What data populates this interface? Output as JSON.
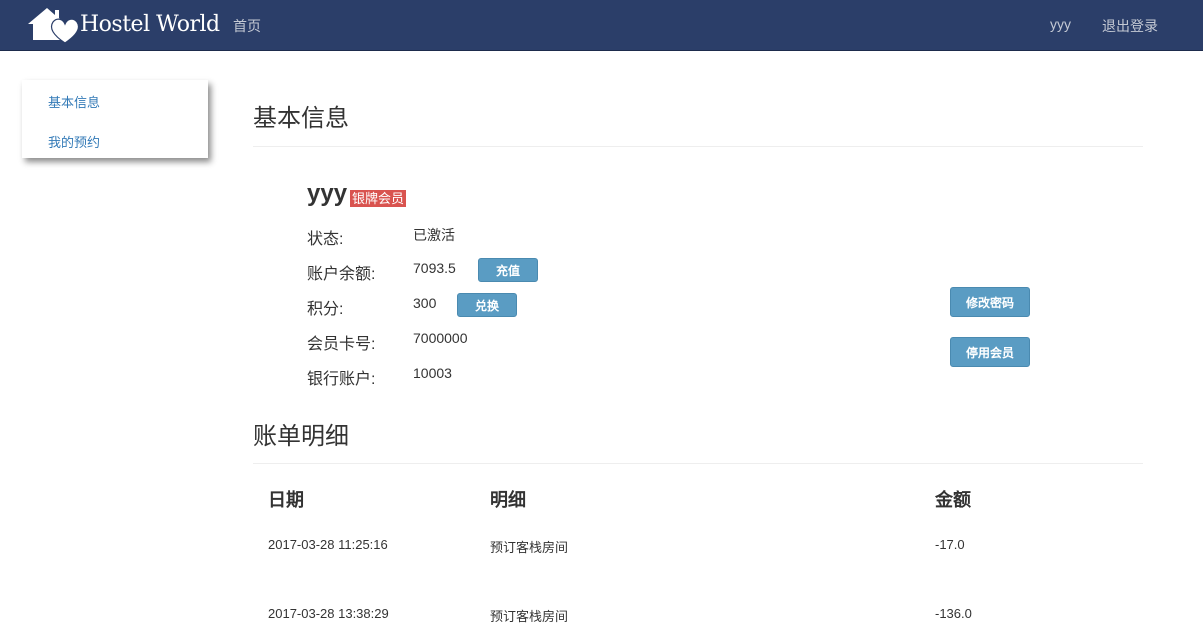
{
  "navbar": {
    "brand": "Hostel World",
    "home": "首页",
    "username": "yyy",
    "logout": "退出登录",
    "background": "#2b3e69"
  },
  "sidebar": {
    "items": [
      {
        "label": "基本信息"
      },
      {
        "label": "我的预约"
      }
    ]
  },
  "basic_info": {
    "title": "基本信息",
    "username": "yyy",
    "badge": "银牌会员",
    "fields": [
      {
        "label": "状态:",
        "value": "已激活"
      },
      {
        "label": "账户余额:",
        "value": "7093.5"
      },
      {
        "label": "积分:",
        "value": "300"
      },
      {
        "label": "会员卡号:",
        "value": "7000000"
      },
      {
        "label": "银行账户:",
        "value": "10003"
      }
    ],
    "recharge_button": "充值",
    "exchange_button": "兑换",
    "change_password_button": "修改密码",
    "deactivate_button": "停用会员"
  },
  "bill": {
    "title": "账单明细",
    "columns": [
      "日期",
      "明细",
      "金额"
    ],
    "rows": [
      {
        "date": "2017-03-28 11:25:16",
        "detail": "预订客栈房间",
        "amount": "-17.0"
      },
      {
        "date": "2017-03-28 13:38:29",
        "detail": "预订客栈房间",
        "amount": "-136.0"
      }
    ]
  },
  "colors": {
    "accent_button": "#5a9cc3",
    "badge": "#d9534f",
    "link": "#337ab7"
  }
}
